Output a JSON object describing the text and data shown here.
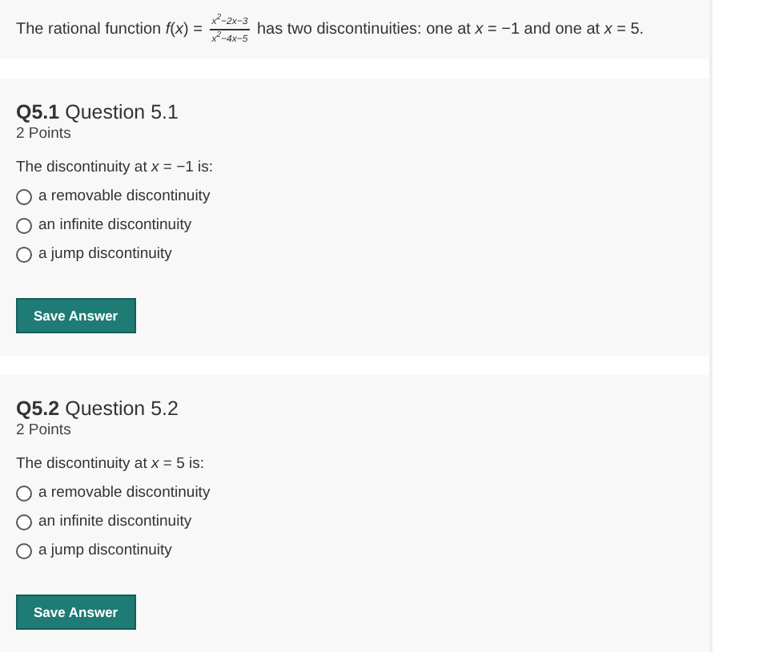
{
  "intro": {
    "before": "The rational function *f*(*x*) =",
    "numerator": "x$^{2}$−2x−3",
    "denominator": "x$^{2}$−4x−5",
    "after": "has two discontinuities: one at *x* = −1 and one at *x* = 5."
  },
  "questions": [
    {
      "number": "Q5.1",
      "title": "Question 5.1",
      "points": "2 Points",
      "prompt": "The discontinuity at *x* = −1 is:",
      "options": [
        {
          "label": "a removable discontinuity",
          "selected": false
        },
        {
          "label": "an infinite discontinuity",
          "selected": false
        },
        {
          "label": "a jump discontinuity",
          "selected": false
        }
      ],
      "button": "Save Answer"
    },
    {
      "number": "Q5.2",
      "title": "Question 5.2",
      "points": "2 Points",
      "prompt": "The discontinuity at *x* = 5 is:",
      "options": [
        {
          "label": "a removable discontinuity",
          "selected": false
        },
        {
          "label": "an infinite discontinuity",
          "selected": false
        },
        {
          "label": "a jump discontinuity",
          "selected": false
        }
      ],
      "button": "Save Answer"
    }
  ]
}
